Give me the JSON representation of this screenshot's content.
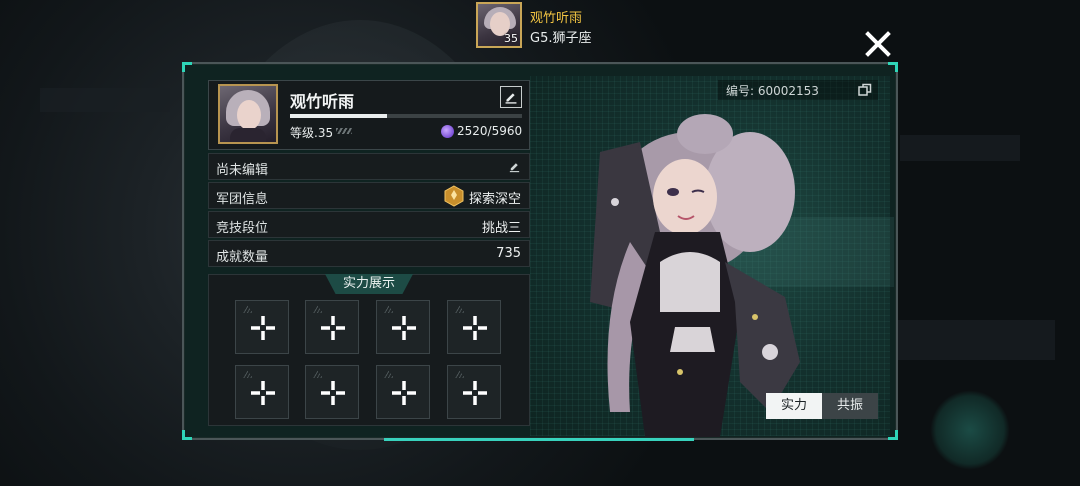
{
  "header": {
    "player_name": "观竹听雨",
    "avatar_level": "35",
    "subtitle": "G5.狮子座"
  },
  "profile": {
    "name": "观竹听雨",
    "level_label": "等级.35",
    "exp_text": "2520/5960",
    "exp_progress": 0.42,
    "uid_text": "编号: 60002153"
  },
  "rows": [
    {
      "label": "尚未编辑",
      "value": ""
    },
    {
      "label": "军团信息",
      "value": "探索深空"
    },
    {
      "label": "竞技段位",
      "value": "挑战三"
    },
    {
      "label": "成就数量",
      "value": "735"
    }
  ],
  "showcase": {
    "title": "实力展示",
    "slot_count": 8
  },
  "tabs": [
    {
      "label": "实力",
      "active": true
    },
    {
      "label": "共振",
      "active": false
    }
  ],
  "colors": {
    "accent": "#2fd5b8",
    "name_gold": "#f2c442",
    "panel": "#0f2321"
  },
  "icons": [
    "close-icon",
    "edit-icon",
    "copy-icon",
    "exp-gem-icon",
    "legion-badge-icon",
    "plus-icon"
  ]
}
